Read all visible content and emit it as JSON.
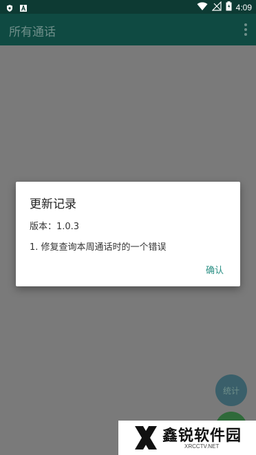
{
  "status_bar": {
    "time": "4:09"
  },
  "app_bar": {
    "title": "所有通话"
  },
  "dialog": {
    "title": "更新记录",
    "version": "版本：1.0.3",
    "note": "1. 修复查询本周通话时的一个错误",
    "confirm_label": "确认"
  },
  "fab": {
    "stats_label": "统计"
  },
  "watermark": {
    "brand": "鑫锐软件园",
    "domain": "XRCCTV.NET"
  },
  "colors": {
    "status_bar": "#0d3a33",
    "app_bar": "#0f4a42",
    "scrim": "#7a7a7a",
    "accent": "#2a8f84"
  }
}
